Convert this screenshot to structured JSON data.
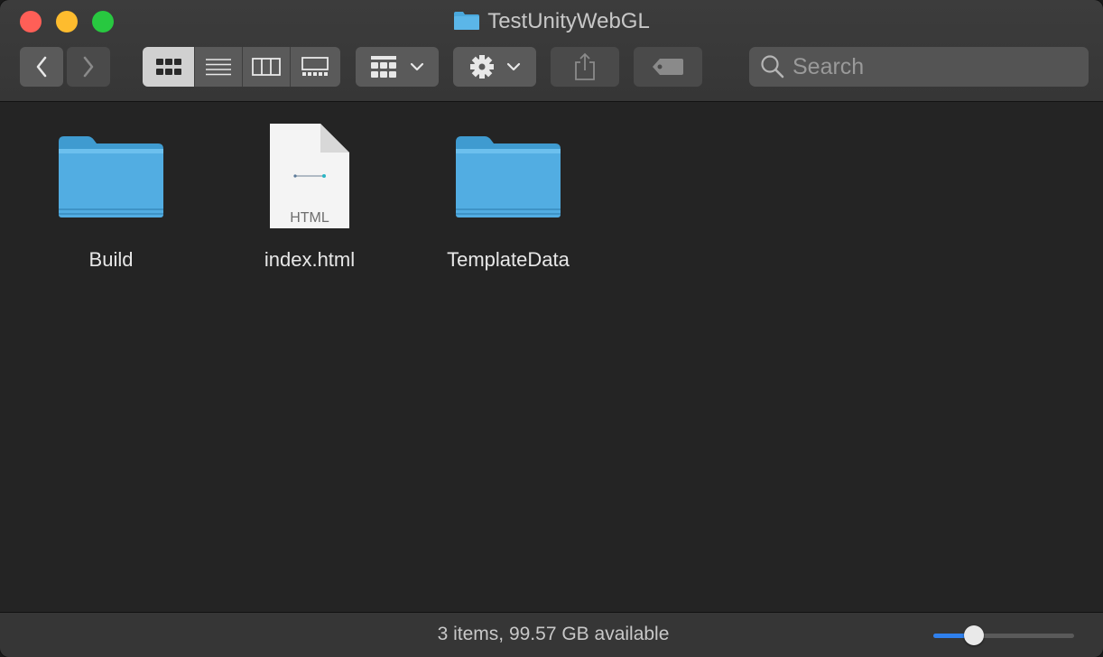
{
  "window": {
    "title": "TestUnityWebGL"
  },
  "toolbar": {
    "back_icon": "chevron-left-icon",
    "forward_icon": "chevron-right-icon",
    "views": [
      "icon-view",
      "list-view",
      "column-view",
      "gallery-view"
    ],
    "active_view": "icon-view",
    "group_icon": "group-grid-icon",
    "action_icon": "gear-icon",
    "share_icon": "share-icon",
    "tag_icon": "tag-icon"
  },
  "search": {
    "placeholder": "Search"
  },
  "files": [
    {
      "name": "Build",
      "kind": "folder"
    },
    {
      "name": "index.html",
      "kind": "file",
      "badge": "HTML"
    },
    {
      "name": "TemplateData",
      "kind": "folder"
    }
  ],
  "status": {
    "text": "3 items, 99.57 GB available"
  },
  "icon_size_slider": {
    "value": 0.25
  },
  "colors": {
    "accent": "#2f80ed",
    "folder": "#4aa8dc"
  }
}
